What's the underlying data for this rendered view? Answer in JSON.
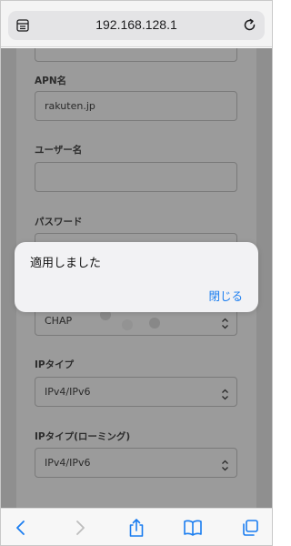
{
  "browser": {
    "url": "192.168.128.1",
    "icons": {
      "reader": "reader-view-icon",
      "reload": "reload-icon",
      "back": "back-icon",
      "forward": "forward-icon",
      "share": "share-icon",
      "bookmarks": "bookmarks-icon",
      "tabs": "tabs-icon"
    }
  },
  "form": {
    "apn": {
      "label": "APN名",
      "value": "rakuten.jp"
    },
    "username": {
      "label": "ユーザー名",
      "value": ""
    },
    "password": {
      "label": "パスワード",
      "value": ""
    },
    "auth": {
      "value": "CHAP"
    },
    "ip_type": {
      "label": "IPタイプ",
      "value": "IPv4/IPv6"
    },
    "ip_type_roaming": {
      "label": "IPタイプ(ローミング)",
      "value": "IPv4/IPv6"
    }
  },
  "dialog": {
    "message": "適用しました",
    "close_label": "閉じる"
  },
  "colors": {
    "accent": "#1a7df0",
    "backdrop": "#8f8f8f"
  }
}
